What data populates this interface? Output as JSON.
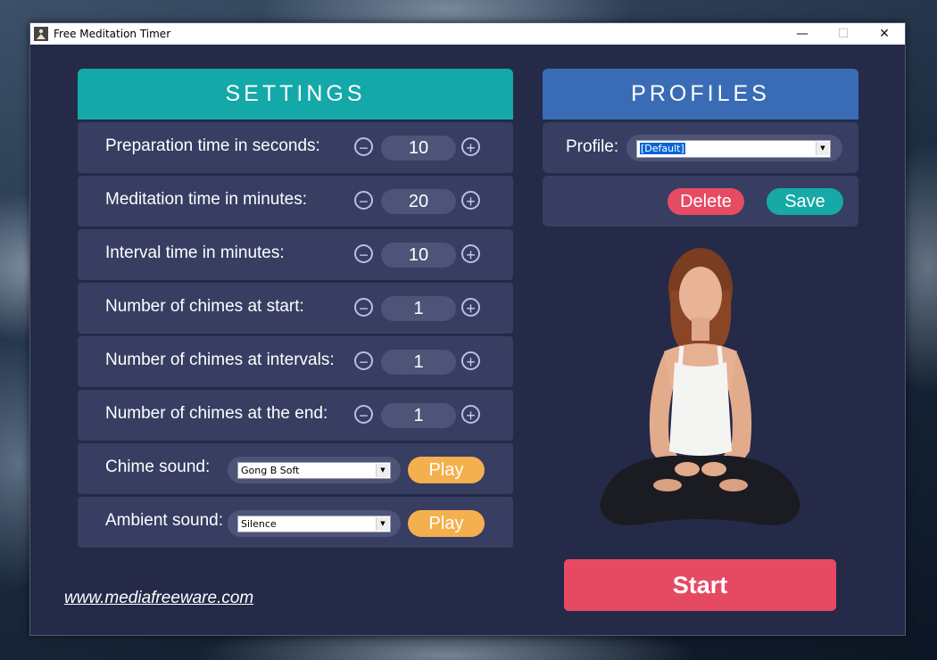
{
  "window": {
    "title": "Free Meditation Timer",
    "controls": [
      "—",
      "☐",
      "✕"
    ]
  },
  "settings": {
    "header": "SETTINGS",
    "minus": "−",
    "plus": "+",
    "rows": [
      {
        "label": "Preparation time in seconds:",
        "value": "10"
      },
      {
        "label": "Meditation time in minutes:",
        "value": "20"
      },
      {
        "label": "Interval time in minutes:",
        "value": "10"
      },
      {
        "label": "Number of chimes at start:",
        "value": "1"
      },
      {
        "label": "Number of chimes at intervals:",
        "value": "1"
      },
      {
        "label": "Number of chimes at the end:",
        "value": "1"
      }
    ],
    "chime": {
      "label": "Chime sound:",
      "selected": "Gong B Soft",
      "play": "Play"
    },
    "ambient": {
      "label": "Ambient sound:",
      "selected": "Silence",
      "play": "Play"
    }
  },
  "profiles": {
    "header": "PROFILES",
    "label": "Profile:",
    "selected": "[Default]",
    "delete": "Delete",
    "save": "Save"
  },
  "start": "Start",
  "link": "www.mediafreeware.com",
  "colors": {
    "settings_header": "#14a8a8",
    "profiles_header": "#3a6cb6",
    "play": "#f5b04e",
    "delete": "#e54b63",
    "save": "#16a9a5",
    "start": "#e64a63"
  }
}
